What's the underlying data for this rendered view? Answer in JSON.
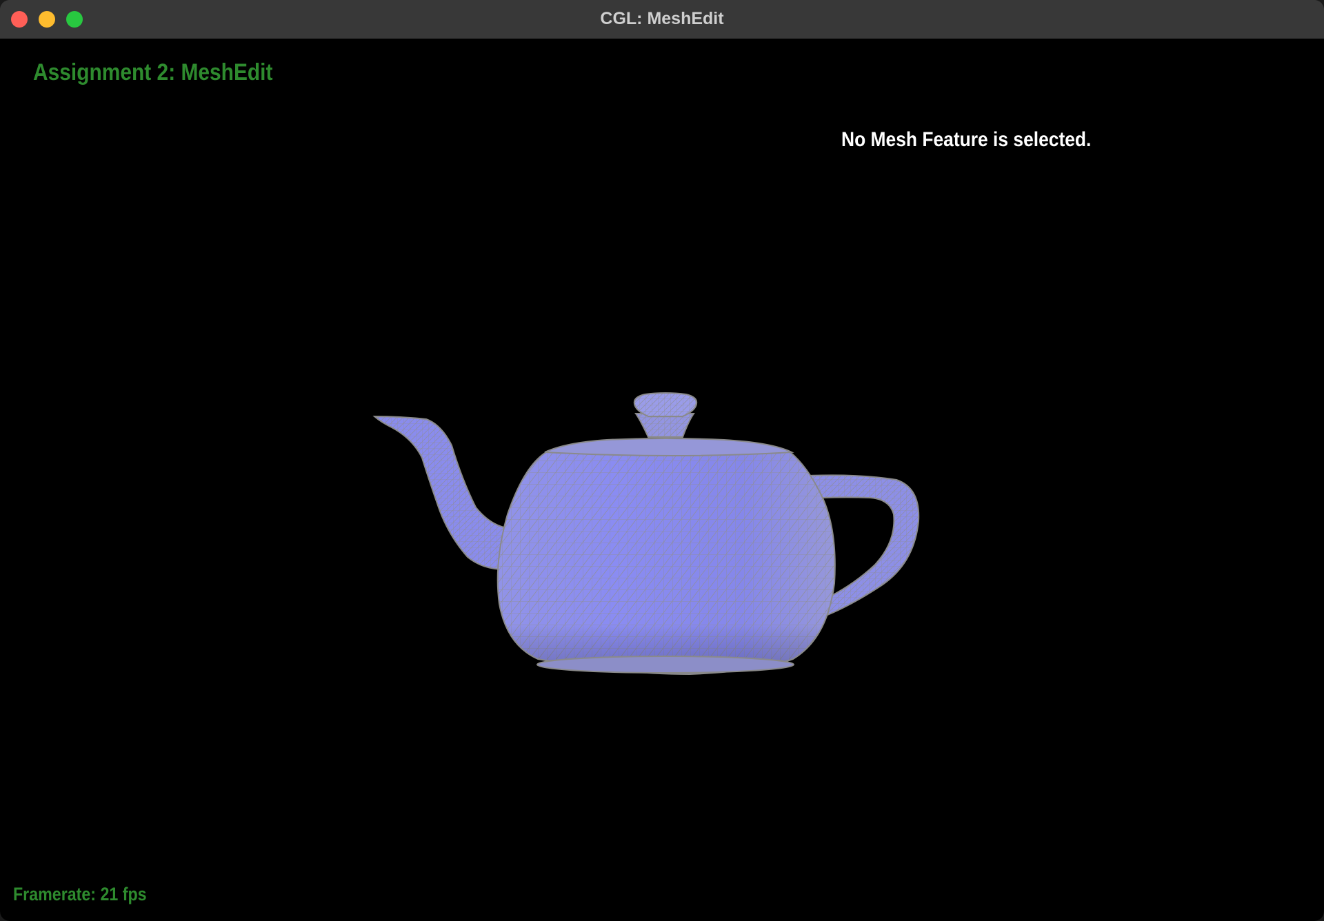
{
  "window": {
    "title": "CGL: MeshEdit"
  },
  "viewport": {
    "assignment_title": "Assignment 2: MeshEdit",
    "feature_status": "No Mesh Feature is selected.",
    "framerate": "Framerate: 21 fps"
  },
  "scene": {
    "object": "teapot-mesh",
    "surface_color": "#8a8cf0",
    "wire_color": "#8d8d8d",
    "background_color": "#000000"
  },
  "colors": {
    "overlay_text_green": "#2e8b2e",
    "overlay_text_white": "#ffffff",
    "titlebar": "#383838"
  }
}
